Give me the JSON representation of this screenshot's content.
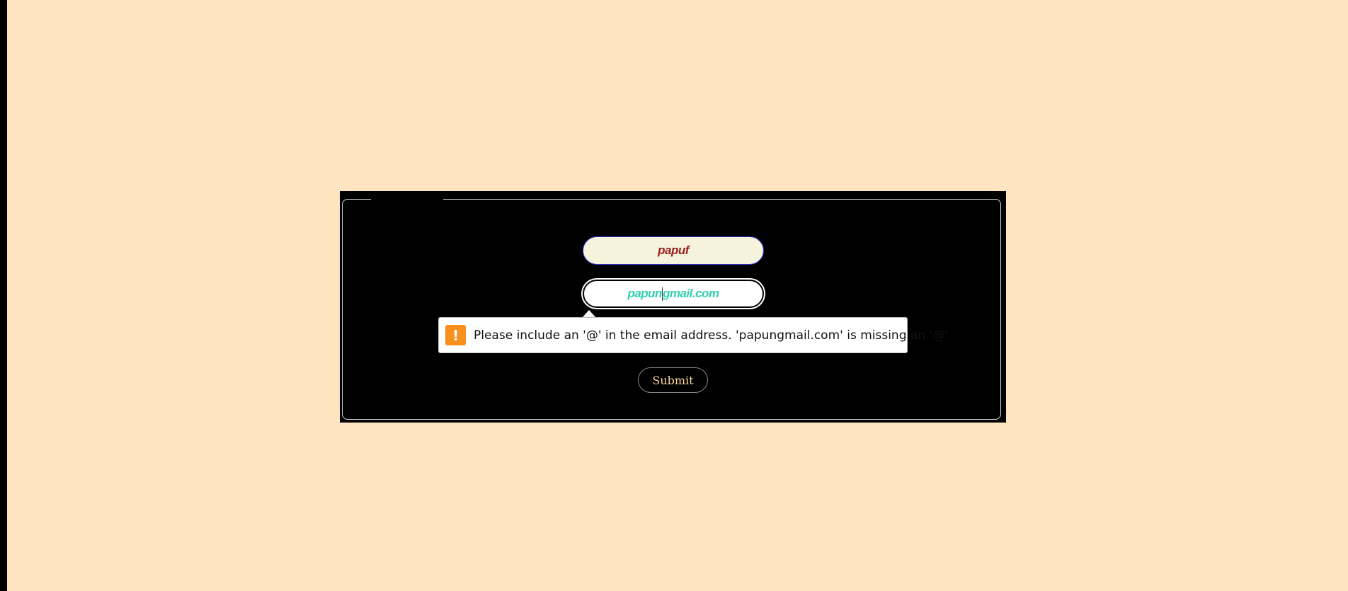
{
  "form": {
    "name_value": "papuf",
    "email_value_before_caret": "papun",
    "email_value_after_caret": "gmail.com",
    "submit_label": "Submit"
  },
  "validation": {
    "icon": "exclamation-icon",
    "message": "Please include an '@' in the email address. 'papungmail.com' is missing an '@'."
  },
  "colors": {
    "page_background": "#ffe4c2",
    "panel_background": "#000000",
    "name_text": "#9b1c1c",
    "email_text": "#2fd1b0",
    "submit_text": "#ffd79a",
    "warning_icon": "#f7901e"
  }
}
